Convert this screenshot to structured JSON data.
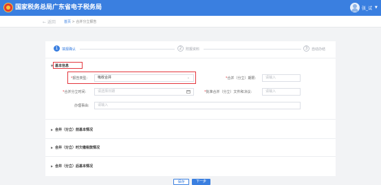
{
  "header": {
    "brand_title": "国家税务总局广东省电子税务局",
    "username": "张_试"
  },
  "nav": {
    "back_label": "← 返回",
    "breadcrumb_home": "首页",
    "breadcrumb_sep": " > ",
    "breadcrumb_current": "合并分立报告"
  },
  "steps": [
    {
      "num": "1",
      "label": "填报确认"
    },
    {
      "num": "2",
      "label": "附报资料"
    },
    {
      "num": "3",
      "label": "自动办结"
    }
  ],
  "basic_info": {
    "title": "基本信息",
    "fields": {
      "report_type": {
        "label": "报告类型:",
        "value": "吸收合并"
      },
      "merge_date": {
        "label": "合并（分立）期限:",
        "placeholder": "请输入"
      },
      "merge_time": {
        "label": "合并分立时间:",
        "placeholder": "请选择日期"
      },
      "approval_doc": {
        "label": "批准合并（分立）文件和决议:",
        "placeholder": "请输入"
      },
      "remark": {
        "label": "办理事由:",
        "placeholder": "请输入"
      }
    }
  },
  "sections": [
    "合并（分立）前基本情况",
    "合并（分立）时欠缴税款情况",
    "合并（分立）后基本情况"
  ],
  "buttons": {
    "save": "保存",
    "next": "下一步"
  },
  "colors": {
    "primary": "#3a7fe0",
    "highlight": "#e3343b"
  },
  "icons": {
    "emblem": "national-emblem-icon",
    "avatar": "user-avatar-icon",
    "calendar": "calendar-icon",
    "select": "chevron-down-icon"
  }
}
